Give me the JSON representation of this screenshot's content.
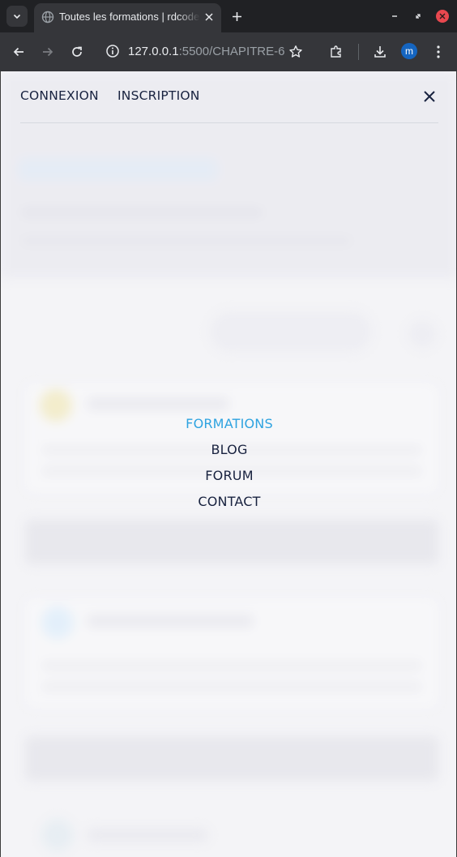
{
  "browser": {
    "tab_title": "Toutes les formations | rdcode",
    "url_host": "127.0.0.1",
    "url_rest": ":5500/CHAPITRE-6...",
    "profile_initial": "m"
  },
  "menu": {
    "auth": {
      "login": "CONNEXION",
      "signup": "INSCRIPTION"
    },
    "nav": [
      {
        "label": "FORMATIONS",
        "active": true
      },
      {
        "label": "BLOG",
        "active": false
      },
      {
        "label": "FORUM",
        "active": false
      },
      {
        "label": "CONTACT",
        "active": false
      }
    ]
  },
  "colors": {
    "nav_active": "#2ea3e0",
    "nav_text": "#18223f",
    "browser_bg": "#202124",
    "toolbar_bg": "#35363a"
  }
}
